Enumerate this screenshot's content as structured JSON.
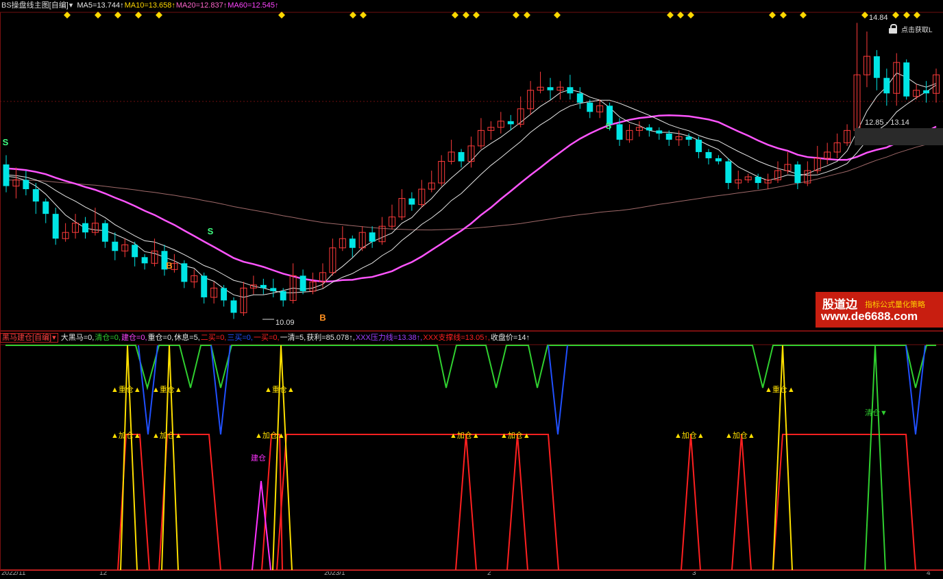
{
  "main_chart": {
    "selector": "BS操盘线主图[自编]",
    "ma": [
      {
        "label": "MA5=13.744↑",
        "color": "#e8e8e8"
      },
      {
        "label": "MA10=13.658↑",
        "color": "#ffd800"
      },
      {
        "label": "MA20=12.837↑",
        "color": "#ff66cc"
      },
      {
        "label": "MA60=12.545↑",
        "color": "#ff44ff"
      }
    ],
    "peak_label": "14.84",
    "low_label": "10.09",
    "quote_text": "12.85 - 13.14",
    "lock_text": "点击获取L",
    "buy_marker": "B",
    "sell_marker": "S"
  },
  "indicator": {
    "selector": "黑马建仓[自编]",
    "items": [
      {
        "label": "大黑马=0,",
        "color": "#e8e8e8"
      },
      {
        "label": "清仓=0,",
        "color": "#30d030"
      },
      {
        "label": "建仓=0,",
        "color": "#ff44ff"
      },
      {
        "label": "重仓=0,",
        "color": "#e8e8e8"
      },
      {
        "label": "休息=5,",
        "color": "#e8e8e8"
      },
      {
        "label": "二买=0,",
        "color": "#ff2020"
      },
      {
        "label": "三买=0,",
        "color": "#2050ff"
      },
      {
        "label": "一买=0,",
        "color": "#ff2020"
      },
      {
        "label": "一清=5,",
        "color": "#e8e8e8"
      },
      {
        "label": "获利=85.078↑,",
        "color": "#e8e8e8"
      },
      {
        "label": "XXX压力线=13.38↑,",
        "color": "#a040ff"
      },
      {
        "label": "XXX支撑线=13.05↑,",
        "color": "#ff2020"
      },
      {
        "label": "收盘价=14↑",
        "color": "#e8e8e8"
      }
    ],
    "labels": {
      "heavy": "▲重仓▲",
      "add": "▲加仓▲",
      "build": "建仓",
      "clear": "清仓▼"
    }
  },
  "watermark": {
    "brand": "股道边",
    "tagline": "指标公式量化策略",
    "site": "www.de6688.com"
  },
  "bottom_axis": [
    "2022/11",
    "12",
    "2023/1",
    "2",
    "3",
    "4"
  ],
  "colors": {
    "up": "#ff3b3b",
    "down": "#00e5e5",
    "ma5": "#e8e8e8",
    "ma10": "#e8e8e8",
    "ma20": "#ff55ff",
    "ma60": "#a06a6a",
    "diamond": "#ffd800",
    "grid": "#701010"
  },
  "chart_data": {
    "type": "candlestick",
    "title": "",
    "candles": [
      [
        12.55,
        12.2,
        12.7,
        12.1
      ],
      [
        12.2,
        12.3,
        12.5,
        12.0
      ],
      [
        12.3,
        12.15,
        12.45,
        12.05
      ],
      [
        12.15,
        11.95,
        12.25,
        11.75
      ],
      [
        11.95,
        11.75,
        12.0,
        11.6
      ],
      [
        11.75,
        11.35,
        11.85,
        11.25
      ],
      [
        11.35,
        11.45,
        11.6,
        11.3
      ],
      [
        11.45,
        11.6,
        11.75,
        11.35
      ],
      [
        11.6,
        11.45,
        11.7,
        11.35
      ],
      [
        11.45,
        11.6,
        11.85,
        11.4
      ],
      [
        11.6,
        11.3,
        11.65,
        11.2
      ],
      [
        11.3,
        11.15,
        11.45,
        11.0
      ],
      [
        11.15,
        11.25,
        11.35,
        11.05
      ],
      [
        11.25,
        11.05,
        11.3,
        10.9
      ],
      [
        11.05,
        10.95,
        11.1,
        10.85
      ],
      [
        10.95,
        11.15,
        11.35,
        10.9
      ],
      [
        11.15,
        10.85,
        11.25,
        10.75
      ],
      [
        10.85,
        10.95,
        11.1,
        10.8
      ],
      [
        10.95,
        10.65,
        11.0,
        10.55
      ],
      [
        10.65,
        10.75,
        10.85,
        10.55
      ],
      [
        10.75,
        10.4,
        10.8,
        10.3
      ],
      [
        10.4,
        10.55,
        10.65,
        10.3
      ],
      [
        10.55,
        10.35,
        10.6,
        10.25
      ],
      [
        10.35,
        10.15,
        10.4,
        10.05
      ],
      [
        10.15,
        10.55,
        10.65,
        10.1
      ],
      [
        10.55,
        10.6,
        10.75,
        10.45
      ],
      [
        10.6,
        10.55,
        10.7,
        10.45
      ],
      [
        10.55,
        10.5,
        10.7,
        10.4
      ],
      [
        10.5,
        10.35,
        10.55,
        10.25
      ],
      [
        10.35,
        10.75,
        10.95,
        10.3
      ],
      [
        10.75,
        10.5,
        10.85,
        10.45
      ],
      [
        10.5,
        10.65,
        10.8,
        10.45
      ],
      [
        10.65,
        10.8,
        10.95,
        10.55
      ],
      [
        10.8,
        11.2,
        11.35,
        10.75
      ],
      [
        11.2,
        11.35,
        11.55,
        11.15
      ],
      [
        11.35,
        11.2,
        11.4,
        11.05
      ],
      [
        11.2,
        11.45,
        11.55,
        11.15
      ],
      [
        11.45,
        11.3,
        11.55,
        11.2
      ],
      [
        11.3,
        11.55,
        11.7,
        11.25
      ],
      [
        11.55,
        11.7,
        11.9,
        11.5
      ],
      [
        11.7,
        12.0,
        12.15,
        11.65
      ],
      [
        12.0,
        11.9,
        12.1,
        11.8
      ],
      [
        11.9,
        12.15,
        12.3,
        11.85
      ],
      [
        12.15,
        12.25,
        12.45,
        12.1
      ],
      [
        12.25,
        12.6,
        12.7,
        12.2
      ],
      [
        12.6,
        12.75,
        12.95,
        12.55
      ],
      [
        12.75,
        12.6,
        12.8,
        12.5
      ],
      [
        12.6,
        12.85,
        13.0,
        12.5
      ],
      [
        12.85,
        13.1,
        13.3,
        12.8
      ],
      [
        13.1,
        13.15,
        13.25,
        12.95
      ],
      [
        13.15,
        13.25,
        13.4,
        13.05
      ],
      [
        13.25,
        13.2,
        13.35,
        13.1
      ],
      [
        13.2,
        13.45,
        13.65,
        13.15
      ],
      [
        13.45,
        13.75,
        13.9,
        13.35
      ],
      [
        13.75,
        13.8,
        14.05,
        13.7
      ],
      [
        13.8,
        13.75,
        13.95,
        13.6
      ],
      [
        13.75,
        13.8,
        13.9,
        13.6
      ],
      [
        13.8,
        13.7,
        14.0,
        13.6
      ],
      [
        13.7,
        13.55,
        13.8,
        13.45
      ],
      [
        13.55,
        13.4,
        13.6,
        13.3
      ],
      [
        13.4,
        13.5,
        13.6,
        13.3
      ],
      [
        13.5,
        13.2,
        13.55,
        13.1
      ],
      [
        13.2,
        12.95,
        13.3,
        12.85
      ],
      [
        12.95,
        13.1,
        13.2,
        12.9
      ],
      [
        13.1,
        13.15,
        13.25,
        13.0
      ],
      [
        13.15,
        13.1,
        13.2,
        13.0
      ],
      [
        13.1,
        13.05,
        13.15,
        12.95
      ],
      [
        13.05,
        12.95,
        13.1,
        12.85
      ],
      [
        12.95,
        13.0,
        13.1,
        12.85
      ],
      [
        13.0,
        12.95,
        13.05,
        12.85
      ],
      [
        12.95,
        12.75,
        13.0,
        12.65
      ],
      [
        12.75,
        12.65,
        12.8,
        12.55
      ],
      [
        12.65,
        12.6,
        12.7,
        12.55
      ],
      [
        12.6,
        12.25,
        12.65,
        12.15
      ],
      [
        12.25,
        12.3,
        12.45,
        12.15
      ],
      [
        12.3,
        12.35,
        12.4,
        12.25
      ],
      [
        12.35,
        12.25,
        12.4,
        12.15
      ],
      [
        12.25,
        12.3,
        12.4,
        12.15
      ],
      [
        12.3,
        12.45,
        12.6,
        12.25
      ],
      [
        12.45,
        12.55,
        12.75,
        12.4
      ],
      [
        12.55,
        12.25,
        12.6,
        12.15
      ],
      [
        12.25,
        12.45,
        12.6,
        12.2
      ],
      [
        12.45,
        12.65,
        12.85,
        12.4
      ],
      [
        12.65,
        12.75,
        12.9,
        12.55
      ],
      [
        12.75,
        12.9,
        13.05,
        12.65
      ],
      [
        12.9,
        13.1,
        13.2,
        12.85
      ],
      [
        13.1,
        14.0,
        14.84,
        13.0
      ],
      [
        14.0,
        14.3,
        14.7,
        13.8
      ],
      [
        14.3,
        13.95,
        14.4,
        13.75
      ],
      [
        13.95,
        13.7,
        14.1,
        13.5
      ],
      [
        13.7,
        14.2,
        14.35,
        13.5
      ],
      [
        14.2,
        13.65,
        14.25,
        13.6
      ],
      [
        13.65,
        13.75,
        13.85,
        13.6
      ],
      [
        13.75,
        13.7,
        13.9,
        13.55
      ],
      [
        13.7,
        14.0,
        14.1,
        13.55
      ]
    ],
    "ylim": [
      10.0,
      14.9
    ],
    "ma5_visible": true,
    "ma20_visible": true
  }
}
